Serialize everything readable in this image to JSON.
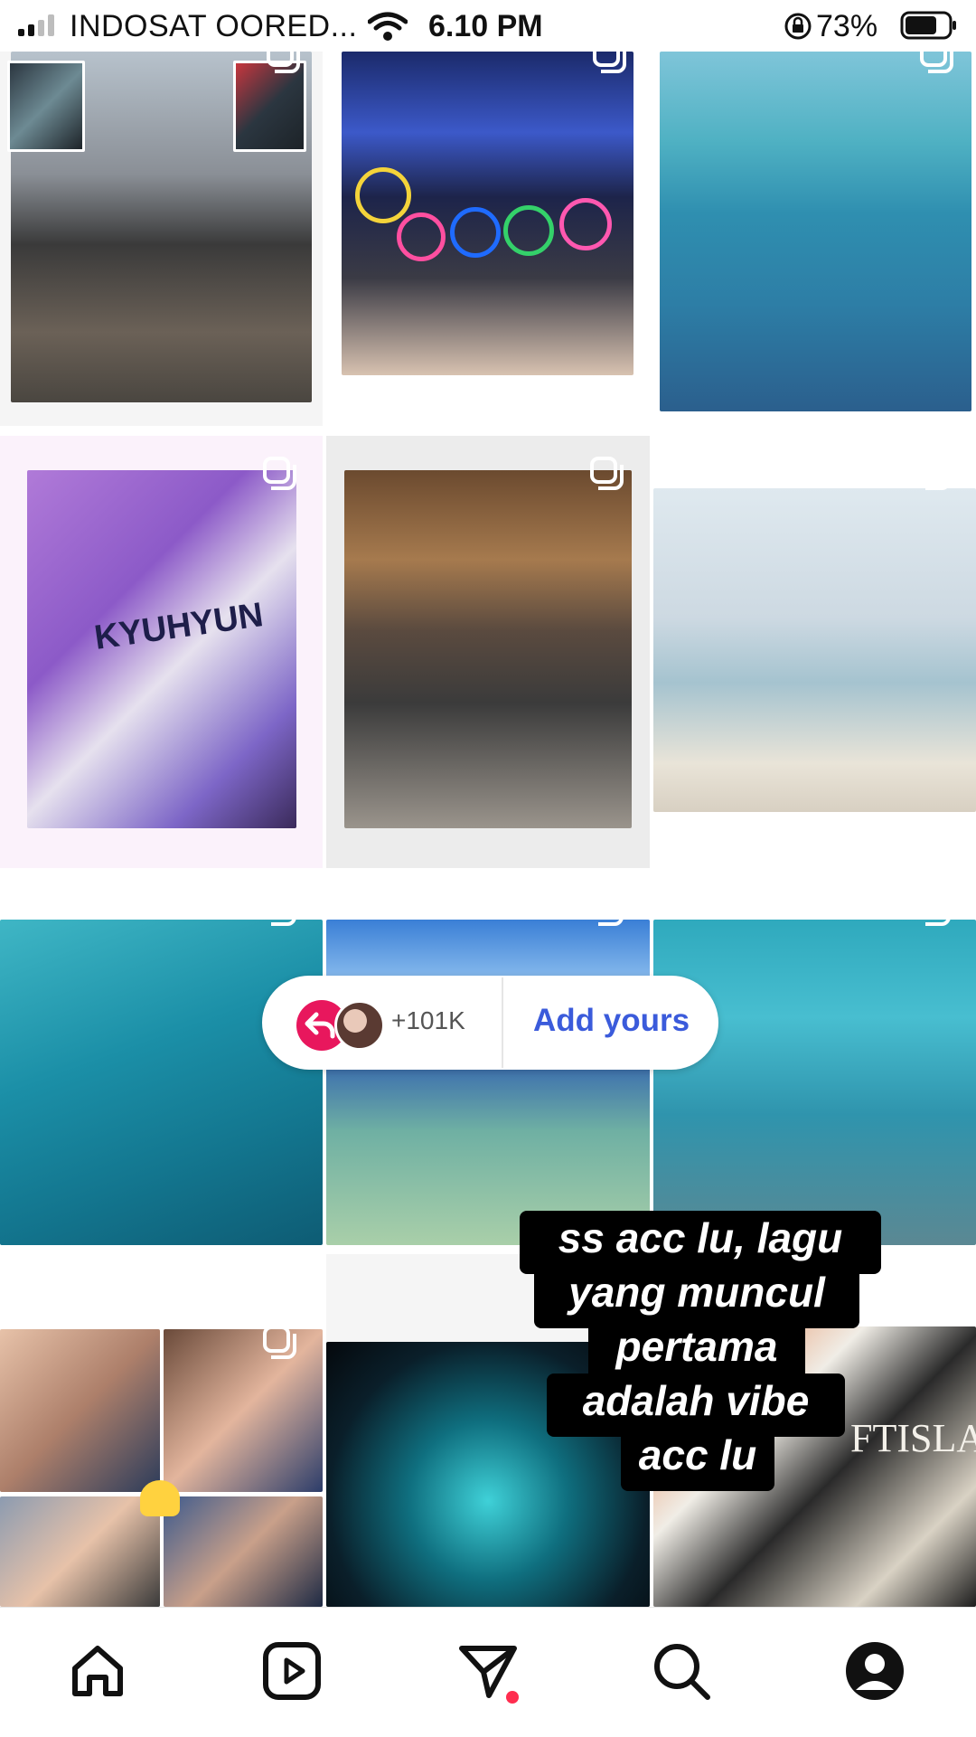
{
  "status_bar": {
    "carrier": "INDOSAT OORED...",
    "time": "6.10 PM",
    "battery_percent": "73%",
    "signal_bars": 4,
    "signal_bars_active": 2
  },
  "grid": {
    "tiles": [
      {
        "row": 1,
        "col": 1,
        "kind": "photo-collage",
        "theme": "concert-selfie"
      },
      {
        "row": 1,
        "col": 2,
        "kind": "photo-collage",
        "theme": "stadium-lightsticks"
      },
      {
        "row": 1,
        "col": 3,
        "kind": "photo-collage",
        "theme": "sea-swimming-sharks"
      },
      {
        "row": 2,
        "col": 1,
        "kind": "photo-collage",
        "theme": "performer-on-stage"
      },
      {
        "row": 2,
        "col": 2,
        "kind": "photo-collage",
        "theme": "group-photo-indoor"
      },
      {
        "row": 2,
        "col": 3,
        "kind": "photo-collage",
        "theme": "beach-palms-group"
      },
      {
        "row": 3,
        "col": 1,
        "kind": "photo",
        "theme": "turquoise-water"
      },
      {
        "row": 3,
        "col": 2,
        "kind": "photo",
        "theme": "person-in-sea"
      },
      {
        "row": 3,
        "col": 3,
        "kind": "photo",
        "theme": "sharks-lagoon"
      },
      {
        "row": 4,
        "col": 1,
        "kind": "photo-collage",
        "theme": "fan-photocards"
      },
      {
        "row": 4,
        "col": 2,
        "kind": "photo",
        "theme": "crystal-lightstick"
      },
      {
        "row": 4,
        "col": 3,
        "kind": "photo-collage",
        "theme": "band-photos"
      }
    ],
    "tile_labels": {
      "jersey_text": "KYUHYUN",
      "band_name": "FTISLAND"
    }
  },
  "add_yours": {
    "count": "+101K",
    "label": "Add yours"
  },
  "caption": {
    "lines": [
      "ss acc lu, lagu",
      "yang muncul",
      "pertama",
      "adalah vibe",
      "acc lu"
    ]
  },
  "nav": {
    "items": [
      "home",
      "reels",
      "messages",
      "search",
      "profile"
    ],
    "messages_has_notification": true
  },
  "colors": {
    "accent_blue": "#3b5bdb",
    "notification_red": "#ff2d4f",
    "reply_pink": "#e8175d"
  }
}
